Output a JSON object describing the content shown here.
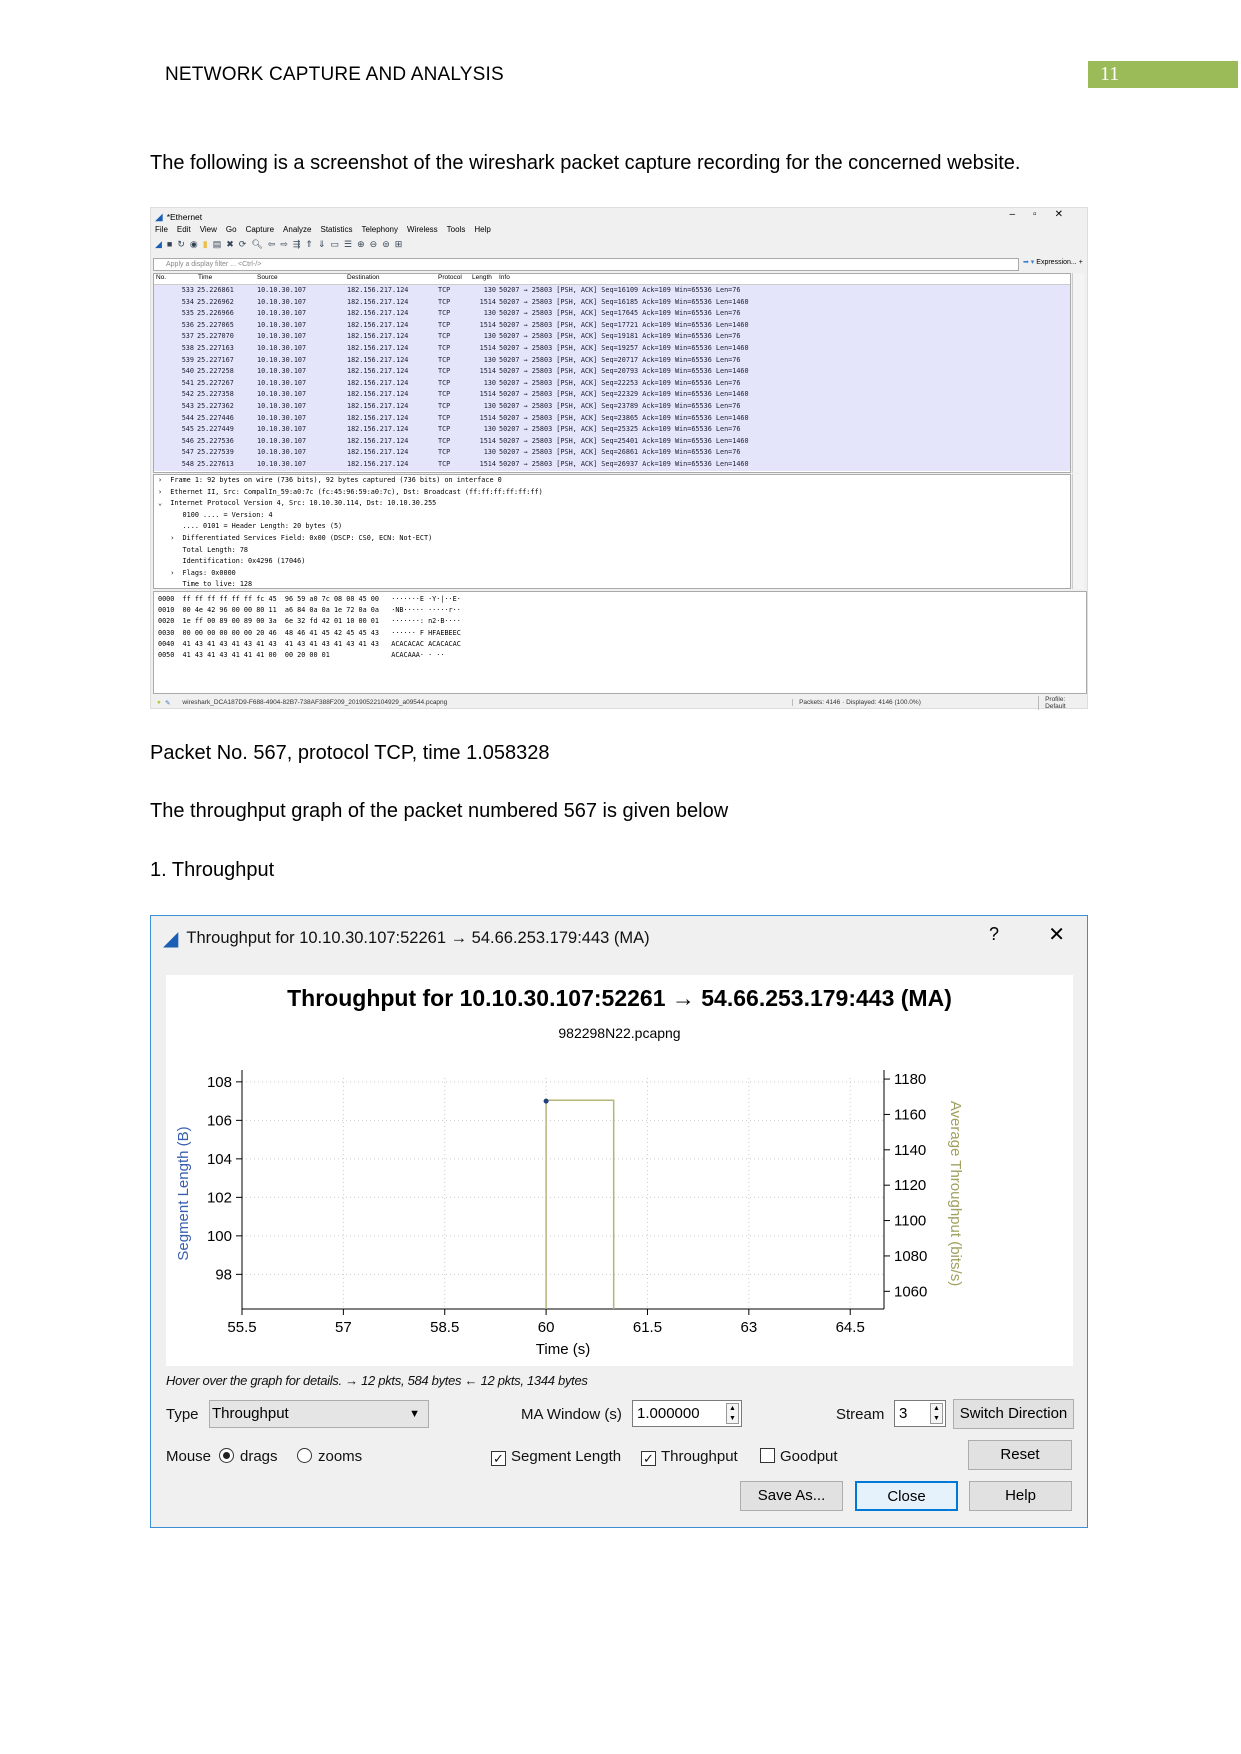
{
  "header": {
    "running_head": "NETWORK CAPTURE AND ANALYSIS",
    "page_number": "11",
    "accent_color": "#9bbb59"
  },
  "body": {
    "intro": "The following is a screenshot of the wireshark packet capture recording for the concerned website.",
    "packet_line": "Packet No. 567, protocol TCP, time 1.058328",
    "graph_intro": "The throughput graph of the packet numbered 567 is given below",
    "section": "1. Throughput"
  },
  "wireshark": {
    "title": "*Ethernet",
    "menu": [
      "File",
      "Edit",
      "View",
      "Go",
      "Capture",
      "Analyze",
      "Statistics",
      "Telephony",
      "Wireless",
      "Tools",
      "Help"
    ],
    "filter_placeholder": "Apply a display filter ... <Ctrl-/>",
    "expression_label": "Expression...",
    "columns": [
      "No.",
      "Time",
      "Source",
      "Destination",
      "Protocol",
      "Length",
      "Info"
    ],
    "rows": [
      [
        "533",
        "25.226861",
        "10.10.30.107",
        "182.156.217.124",
        "TCP",
        "130",
        "50207 → 25803 [PSH, ACK] Seq=16109 Ack=109 Win=65536 Len=76"
      ],
      [
        "534",
        "25.226962",
        "10.10.30.107",
        "182.156.217.124",
        "TCP",
        "1514",
        "50207 → 25803 [PSH, ACK] Seq=16185 Ack=109 Win=65536 Len=1460"
      ],
      [
        "535",
        "25.226966",
        "10.10.30.107",
        "182.156.217.124",
        "TCP",
        "130",
        "50207 → 25803 [PSH, ACK] Seq=17645 Ack=109 Win=65536 Len=76"
      ],
      [
        "536",
        "25.227065",
        "10.10.30.107",
        "182.156.217.124",
        "TCP",
        "1514",
        "50207 → 25803 [PSH, ACK] Seq=17721 Ack=109 Win=65536 Len=1460"
      ],
      [
        "537",
        "25.227070",
        "10.10.30.107",
        "182.156.217.124",
        "TCP",
        "130",
        "50207 → 25803 [PSH, ACK] Seq=19181 Ack=109 Win=65536 Len=76"
      ],
      [
        "538",
        "25.227163",
        "10.10.30.107",
        "182.156.217.124",
        "TCP",
        "1514",
        "50207 → 25803 [PSH, ACK] Seq=19257 Ack=109 Win=65536 Len=1460"
      ],
      [
        "539",
        "25.227167",
        "10.10.30.107",
        "182.156.217.124",
        "TCP",
        "130",
        "50207 → 25803 [PSH, ACK] Seq=20717 Ack=109 Win=65536 Len=76"
      ],
      [
        "540",
        "25.227258",
        "10.10.30.107",
        "182.156.217.124",
        "TCP",
        "1514",
        "50207 → 25803 [PSH, ACK] Seq=20793 Ack=109 Win=65536 Len=1460"
      ],
      [
        "541",
        "25.227267",
        "10.10.30.107",
        "182.156.217.124",
        "TCP",
        "130",
        "50207 → 25803 [PSH, ACK] Seq=22253 Ack=109 Win=65536 Len=76"
      ],
      [
        "542",
        "25.227358",
        "10.10.30.107",
        "182.156.217.124",
        "TCP",
        "1514",
        "50207 → 25803 [PSH, ACK] Seq=22329 Ack=109 Win=65536 Len=1460"
      ],
      [
        "543",
        "25.227362",
        "10.10.30.107",
        "182.156.217.124",
        "TCP",
        "130",
        "50207 → 25803 [PSH, ACK] Seq=23789 Ack=109 Win=65536 Len=76"
      ],
      [
        "544",
        "25.227446",
        "10.10.30.107",
        "182.156.217.124",
        "TCP",
        "1514",
        "50207 → 25803 [PSH, ACK] Seq=23865 Ack=109 Win=65536 Len=1460"
      ],
      [
        "545",
        "25.227449",
        "10.10.30.107",
        "182.156.217.124",
        "TCP",
        "130",
        "50207 → 25803 [PSH, ACK] Seq=25325 Ack=109 Win=65536 Len=76"
      ],
      [
        "546",
        "25.227536",
        "10.10.30.107",
        "182.156.217.124",
        "TCP",
        "1514",
        "50207 → 25803 [PSH, ACK] Seq=25401 Ack=109 Win=65536 Len=1460"
      ],
      [
        "547",
        "25.227539",
        "10.10.30.107",
        "182.156.217.124",
        "TCP",
        "130",
        "50207 → 25803 [PSH, ACK] Seq=26861 Ack=109 Win=65536 Len=76"
      ],
      [
        "548",
        "25.227613",
        "10.10.30.107",
        "182.156.217.124",
        "TCP",
        "1514",
        "50207 → 25803 [PSH, ACK] Seq=26937 Ack=109 Win=65536 Len=1460"
      ]
    ],
    "details": [
      "›  Frame 1: 92 bytes on wire (736 bits), 92 bytes captured (736 bits) on interface 0",
      "›  Ethernet II, Src: CompalIn_59:a0:7c (fc:45:96:59:a0:7c), Dst: Broadcast (ff:ff:ff:ff:ff:ff)",
      "⌄  Internet Protocol Version 4, Src: 10.10.30.114, Dst: 10.10.30.255",
      "      0100 .... = Version: 4",
      "      .... 0101 = Header Length: 20 bytes (5)",
      "   ›  Differentiated Services Field: 0x00 (DSCP: CS0, ECN: Not-ECT)",
      "      Total Length: 78",
      "      Identification: 0x4296 (17046)",
      "   ›  Flags: 0x0000",
      "      Time to live: 128"
    ],
    "hex": [
      "0000  ff ff ff ff ff ff fc 45  96 59 a0 7c 08 00 45 00   ·······E ·Y·|··E·",
      "0010  00 4e 42 96 00 00 80 11  a6 84 0a 0a 1e 72 0a 0a   ·NB····· ·····r··",
      "0020  1e ff 00 89 00 89 00 3a  6e 32 fd 42 01 10 00 01   ·······: n2·B····",
      "0030  00 00 00 00 00 00 20 46  48 46 41 45 42 45 45 43   ······ F HFAEBEEC",
      "0040  41 43 41 43 41 43 41 43  41 43 41 43 41 43 41 43   ACACACAC ACACACAC",
      "0050  41 43 41 43 41 41 41 00  00 20 00 01               ACACAAA· · ··"
    ],
    "status": {
      "file": "wireshark_DCA187D9-F688-4904-82B7-738AF388F209_20190522104929_a09544.pcapng",
      "packets": "Packets: 4146 · Displayed: 4146 (100.0%)",
      "profile": "Profile: Default"
    }
  },
  "dialog": {
    "window_title": "Throughput for 10.10.30.107:52261 → 54.66.253.179:443 (MA)",
    "help": "?",
    "close": "✕",
    "hover_text": "Hover over the graph for details. → 12 pkts, 584 bytes ← 12 pkts, 1344 bytes",
    "type_label": "Type",
    "type_value": "Throughput",
    "ma_label": "MA Window (s)",
    "ma_value": "1.000000",
    "stream_label": "Stream",
    "stream_value": "3",
    "switch_direction": "Switch Direction",
    "mouse_label": "Mouse",
    "drags": "drags",
    "zooms": "zooms",
    "mouse_mode": "drags",
    "segment_length": "Segment Length",
    "segment_length_checked": true,
    "throughput": "Throughput",
    "throughput_checked": true,
    "goodput": "Goodput",
    "goodput_checked": false,
    "reset": "Reset",
    "save_as": "Save As...",
    "close_button": "Close",
    "help_button": "Help"
  },
  "chart_data": {
    "type": "line",
    "title": "Throughput for 10.10.30.107:52261 → 54.66.253.179:443 (MA)",
    "subtitle": "982298N22.pcapng",
    "xlabel": "Time (s)",
    "ylabel": "Segment Length (B)",
    "y2label": "Average Throughput (bits/s)",
    "xlim": [
      55.5,
      65
    ],
    "ylim": [
      96.2,
      108.2
    ],
    "y2lim": [
      1050,
      1180.6
    ],
    "xticks": [
      55.5,
      57,
      58.5,
      60,
      61.5,
      63,
      64.5
    ],
    "yticks": [
      98,
      100,
      102,
      104,
      106,
      108
    ],
    "y2ticks": [
      1060,
      1080,
      1100,
      1120,
      1140,
      1160,
      1180
    ],
    "grid": true,
    "series": [
      {
        "axis": "y2",
        "color": "#b5b57a",
        "step": true,
        "points": [
          [
            60,
            1050
          ],
          [
            60,
            1168
          ],
          [
            61,
            1168
          ],
          [
            61,
            1050
          ]
        ]
      },
      {
        "axis": "y",
        "color": "#1f3f7f",
        "marker": "dot",
        "points": [
          [
            60,
            107
          ]
        ]
      }
    ]
  }
}
